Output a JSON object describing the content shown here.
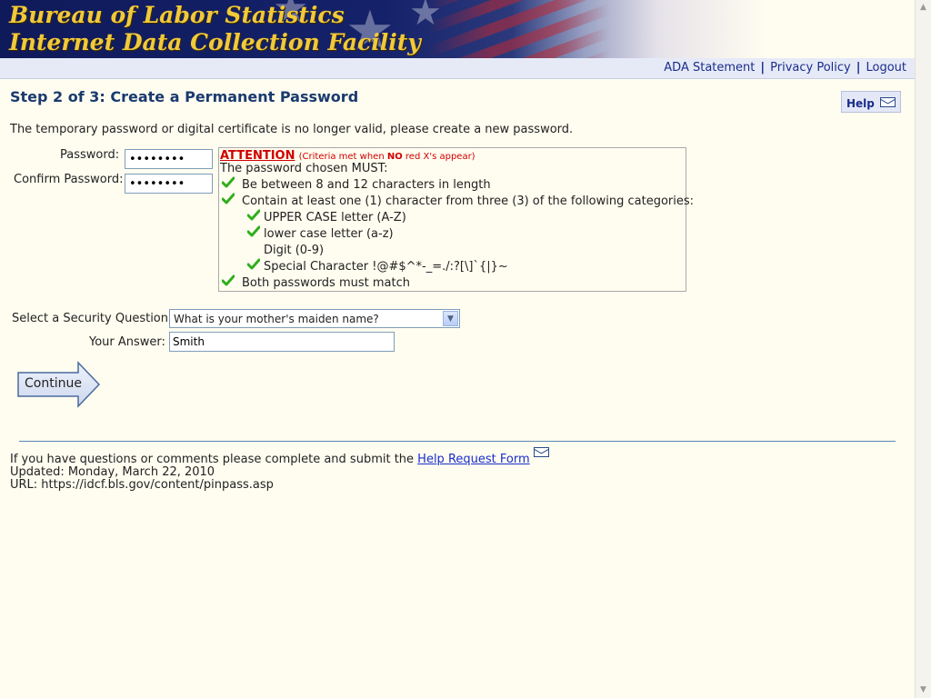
{
  "header": {
    "title_line1": "Bureau of Labor Statistics",
    "title_line2": "Internet Data Collection Facility"
  },
  "nav": {
    "ada": "ADA Statement",
    "privacy": "Privacy Policy",
    "logout": "Logout",
    "separator": "|"
  },
  "page": {
    "step_title": "Step 2 of 3: Create a Permanent Password",
    "help_label": "Help",
    "intro": "The temporary password or digital certificate is no longer valid, please create a new password."
  },
  "form": {
    "password_label": "Password:",
    "password_value": "••••••••",
    "confirm_label": "Confirm Password:",
    "confirm_value": "••••••••",
    "security_question_label": "Select a Security Question:",
    "security_question_value": "What is your mother's maiden name?",
    "answer_label": "Your Answer:",
    "answer_value": "Smith",
    "continue_label": "Continue"
  },
  "criteria": {
    "attention": "ATTENTION",
    "note_pre": "(Criteria met when ",
    "note_bold": "NO",
    "note_post": " red X's appear)",
    "must": "The password chosen MUST:",
    "length": "Be between 8 and 12 characters in length",
    "categories": "Contain at least one (1) character from three (3) of the following categories:",
    "upper": "UPPER CASE letter (A-Z)",
    "lower": "lower case letter (a-z)",
    "digit": "Digit (0-9)",
    "special": "Special Character !@#$^*-_=./:?[\\]`{|}~",
    "match": "Both passwords must match",
    "check_color": "#2fae1c"
  },
  "footer": {
    "questions_pre": "If you have questions or comments please complete and submit the ",
    "help_form_link": "Help Request Form",
    "updated": "Updated: Monday, March 22, 2010",
    "url": "URL: https://idcf.bls.gov/content/pinpass.asp"
  },
  "colors": {
    "title_gold": "#f1c93a",
    "link_blue": "#1a2d8a",
    "attention_red": "#d00000",
    "page_bg": "#fffdf0"
  }
}
